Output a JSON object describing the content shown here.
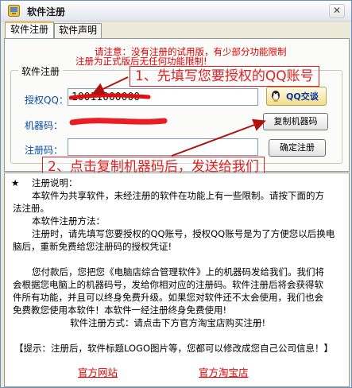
{
  "window": {
    "title": "软件注册",
    "close_glyph": "✕"
  },
  "tabs": [
    {
      "label": "软件注册",
      "active": true
    },
    {
      "label": "软件声明",
      "active": false
    }
  ],
  "notice": {
    "line1": "请注意：没有注册的试用版，有少部分功能限制",
    "line2": "注册为正式版后无任何功能限制!"
  },
  "form": {
    "group_label": "软件注册",
    "qq_label": "授权QQ：",
    "qq_value": "10011000000",
    "machine_label": "机器码：",
    "code_label": "注册码：",
    "code_value": ""
  },
  "buttons": {
    "qq": "QQ交谈",
    "copy_machine": "复制机器码",
    "confirm": "确定注册"
  },
  "callouts": {
    "step1": "1、先填写您要授权的QQ账号",
    "step2": "2、点击复制机器码后，发送给我们"
  },
  "info": {
    "star": "★",
    "heading": "注册说明：",
    "p1a": "本软件为共享软件，未经注册的软件在功能上有一些限制。请按下面的方",
    "p1b": "法注册。",
    "method_title": "本软件注册方法：",
    "p2a": "注册时，请先填写您要授权的QQ账号，授权QQ账号是为了方便您以后换电",
    "p2b": "脑后，重新免费给您注册码的授权凭证!",
    "p3a": "您付款后，您把您《电脑店综合管理软件》上的机器码发给我们。我们将",
    "p3b": "会根据您电脑上的机器码号，发给你相对应的注册码。软件注册后将会获得软",
    "p3c": "件所有功能，并且可以终身免费升级。如果您对软件还不太会使用，我们也会",
    "p3d": "免费教您使用本软件！本软件一经注册终身免费使用!",
    "method_line": "软件注册方式：请点击下方官方淘宝店购买注册!",
    "tip": "【提示：注册后，软件标题LOGO图片等，您都可以修改成您自己公司信息！】"
  },
  "links": {
    "official_site": "官方网站",
    "taobao_store": "官方淘宝店"
  },
  "colors": {
    "accent_red": "#e00000",
    "label_blue": "#0a4aa6",
    "tab_highlight": "#f9b44a"
  }
}
